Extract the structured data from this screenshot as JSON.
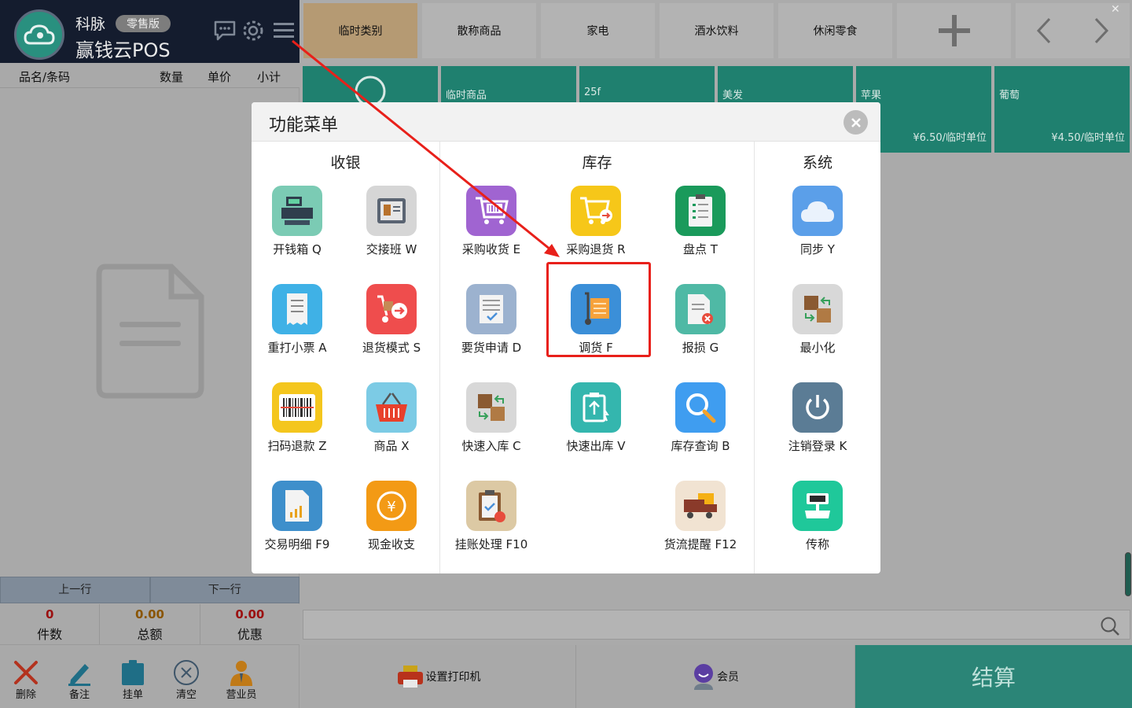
{
  "brand": {
    "name": "科脉",
    "edition": "零售版",
    "product": "赢钱云POS"
  },
  "columns": {
    "name": "品名/条码",
    "qty": "数量",
    "price": "单价",
    "subtotal": "小计"
  },
  "pager": {
    "prev": "上一行",
    "next": "下一行"
  },
  "stats": {
    "count": {
      "value": "0",
      "label": "件数"
    },
    "total": {
      "value": "0.00",
      "label": "总额"
    },
    "discount": {
      "value": "0.00",
      "label": "优惠"
    }
  },
  "tools": {
    "delete": "删除",
    "note": "备注",
    "hold": "挂单",
    "clear": "清空",
    "salesman": "营业员"
  },
  "categories": [
    "临时类别",
    "散称商品",
    "家电",
    "酒水饮料",
    "休闲零食"
  ],
  "products": [
    {
      "name": "临时商品",
      "price": ""
    },
    {
      "name": "25f",
      "price": ""
    },
    {
      "name": "美发",
      "price": ""
    },
    {
      "name": "苹果",
      "price": "¥6.50/临时单位"
    },
    {
      "name": "葡萄",
      "price": "¥4.50/临时单位"
    }
  ],
  "bottom": {
    "printer": "设置打印机",
    "member": "会员",
    "checkout": "结算"
  },
  "modal": {
    "title": "功能菜单",
    "sections": {
      "cashier": {
        "title": "收银",
        "items": [
          "开钱箱 Q",
          "交接班 W",
          "重打小票 A",
          "退货模式 S",
          "扫码退款 Z",
          "商品 X",
          "交易明细 F9",
          "现金收支"
        ]
      },
      "inventory": {
        "title": "库存",
        "items": [
          "采购收货 E",
          "采购退货 R",
          "盘点 T",
          "要货申请 D",
          "调货 F",
          "报损 G",
          "快速入库 C",
          "快速出库 V",
          "库存查询 B",
          "挂账处理 F10",
          "货流提醒 F12"
        ]
      },
      "system": {
        "title": "系统",
        "items": [
          "同步 Y",
          "最小化",
          "注销登录 K",
          "传称"
        ]
      }
    }
  },
  "colors": {
    "accent_teal": "#1f806f",
    "header_dark": "#141c2e",
    "highlight_red": "#e8201a",
    "checkout": "#2b8577"
  }
}
